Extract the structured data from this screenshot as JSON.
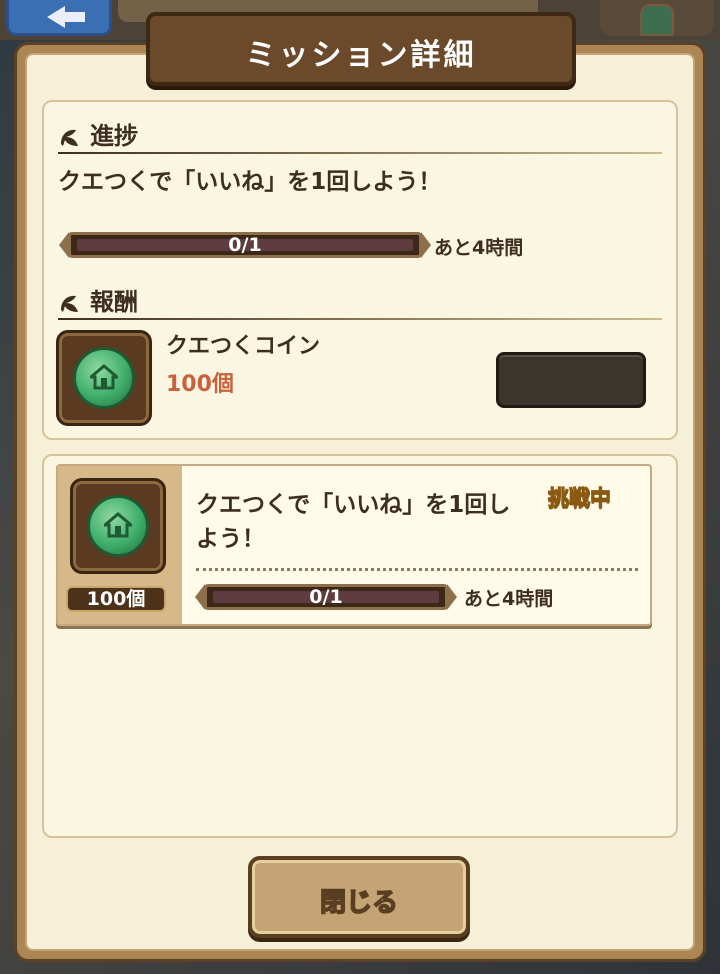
{
  "dialog": {
    "title": "ミッション詳細",
    "close_label": "閉じる"
  },
  "progress_section": {
    "heading": "進捗",
    "description": "クエつくで「いいね」を1回しよう！",
    "progress_text": "0/1",
    "progress_fraction": 0.0,
    "time_left": "あと4時間"
  },
  "reward_section": {
    "heading": "報酬",
    "item_name": "クエつくコイン",
    "item_qty": "100個",
    "item_icon": "green-house-coin-icon"
  },
  "mission_list": [
    {
      "title": "クエつくで「いいね」を1回しよう！",
      "status": "挑戦中",
      "reward_qty": "100個",
      "progress_text": "0/1",
      "progress_fraction": 0.0,
      "time_left": "あと4時間",
      "icon": "green-house-coin-icon"
    }
  ],
  "colors": {
    "panel_bg": "#f7f0d8",
    "title_bg": "#6b4a2c",
    "qty_red": "#c9623c",
    "status_gold": "#e9c53c"
  }
}
